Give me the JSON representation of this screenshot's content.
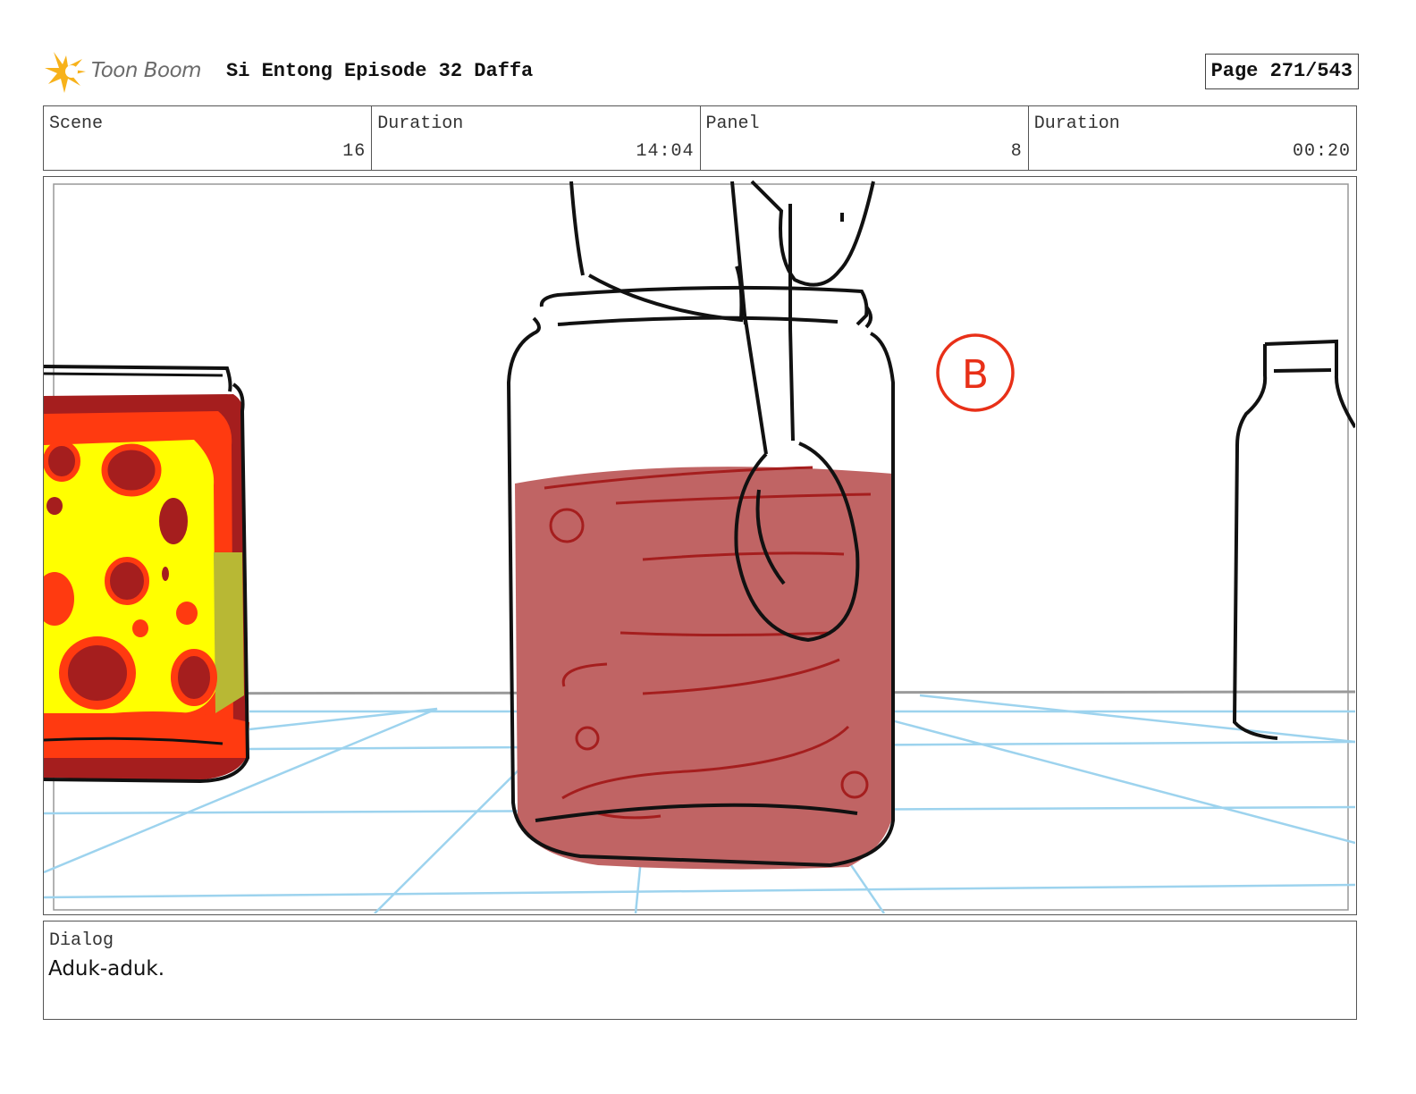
{
  "header": {
    "logo_text": "Toon Boom",
    "title": "Si Entong Episode 32 Daffa",
    "page": "Page 271/543"
  },
  "info": {
    "scene_label": "Scene",
    "scene_value": "16",
    "duration_label": "Duration",
    "duration_value": "14:04",
    "panel_label": "Panel",
    "panel_value": "8",
    "panel_duration_label": "Duration",
    "panel_duration_value": "00:20"
  },
  "drawing": {
    "annotation_mark": "B"
  },
  "dialog": {
    "label": "Dialog",
    "text": "Aduk-aduk."
  },
  "colors": {
    "jam_liquid": "#c06464",
    "jar_red": "#a51e1e",
    "jar_orange": "#ff3a10",
    "jar_yellow": "#ffff00",
    "grid_blue": "#9dd3ee",
    "annotation_red": "#e83018"
  }
}
